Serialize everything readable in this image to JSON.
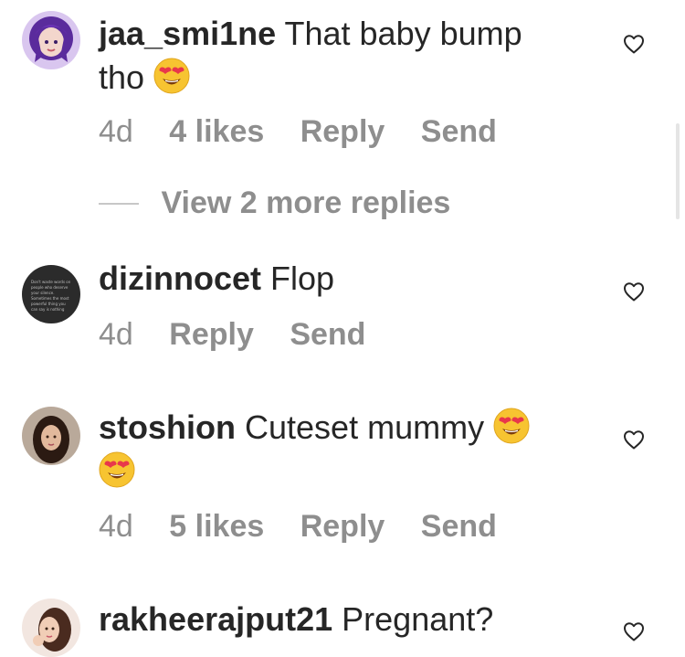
{
  "comments": [
    {
      "username": "jaa_smi1ne",
      "text": "That baby bump tho",
      "emoji": "heart-eyes",
      "age": "4d",
      "likes": "4 likes",
      "reply": "Reply",
      "send": "Send"
    },
    {
      "username": "dizinnocet",
      "text": "Flop",
      "age": "4d",
      "reply": "Reply",
      "send": "Send",
      "avatar_text": "Don't waste words on people who deserve your silence. Sometimes the most powerful thing you can say is nothing"
    },
    {
      "username": "stoshion",
      "text": "Cuteset mummy",
      "emoji": "heart-eyes",
      "age": "4d",
      "likes": "5 likes",
      "reply": "Reply",
      "send": "Send"
    },
    {
      "username": "rakheerajput21",
      "text": "Pregnant?"
    }
  ],
  "view_replies": "View 2 more replies",
  "colors": {
    "text": "#262626",
    "secondary": "#8e8e8e",
    "emoji_face": "#f7c431",
    "emoji_heart": "#e8374b"
  }
}
